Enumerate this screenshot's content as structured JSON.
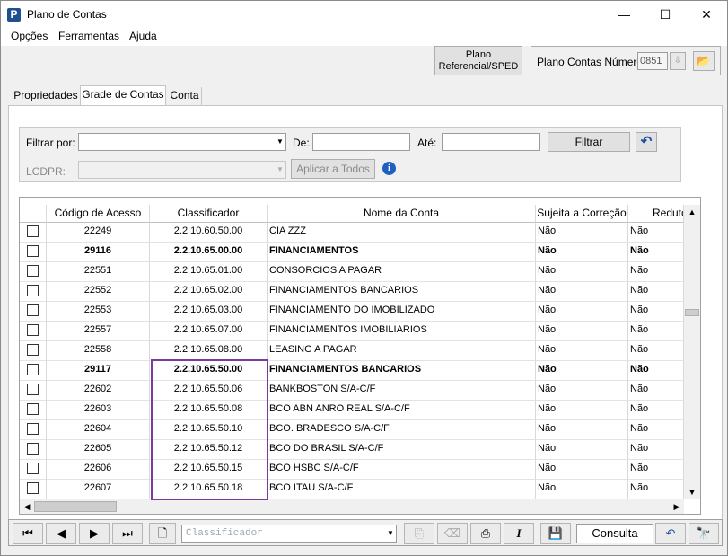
{
  "window": {
    "title": "Plano de Contas",
    "app_icon": "P",
    "minimize": "—",
    "maximize": "☐",
    "close": "✕"
  },
  "menu": {
    "items": [
      "Opções",
      "Ferramentas",
      "Ajuda"
    ]
  },
  "header": {
    "plano_btn_line1": "Plano",
    "plano_btn_line2": "Referencial/SPED",
    "numero_label": "Plano Contas Número",
    "numero_value": "0851",
    "numero_spin": "⇩",
    "folder_icon": "📂"
  },
  "tabs": [
    {
      "label": "Propriedades",
      "active": false
    },
    {
      "label": "Grade de Contas",
      "active": true
    },
    {
      "label": "Conta",
      "active": false
    }
  ],
  "filter": {
    "filtrar_por_label": "Filtrar por:",
    "de_label": "De:",
    "ate_label": "Até:",
    "filtrar_button": "Filtrar",
    "undo_icon": "↶",
    "lcdpr_label": "LCDPR:",
    "aplicar_button": "Aplicar a Todos",
    "info_icon": "i"
  },
  "grid": {
    "columns": [
      "Código de Acesso",
      "Classificador",
      "Nome da Conta",
      "Sujeita a Correção",
      "Redutora"
    ],
    "rows": [
      {
        "cod": "22249",
        "cla": "2.2.10.60.50.00",
        "nome": "CIA ZZZ",
        "suj": "Não",
        "red": "Não",
        "bold": false
      },
      {
        "cod": "29116",
        "cla": "2.2.10.65.00.00",
        "nome": "FINANCIAMENTOS",
        "suj": "Não",
        "red": "Não",
        "bold": true
      },
      {
        "cod": "22551",
        "cla": "2.2.10.65.01.00",
        "nome": "CONSORCIOS A PAGAR",
        "suj": "Não",
        "red": "Não",
        "bold": false
      },
      {
        "cod": "22552",
        "cla": "2.2.10.65.02.00",
        "nome": "FINANCIAMENTOS BANCARIOS",
        "suj": "Não",
        "red": "Não",
        "bold": false
      },
      {
        "cod": "22553",
        "cla": "2.2.10.65.03.00",
        "nome": "FINANCIAMENTO DO IMOBILIZADO",
        "suj": "Não",
        "red": "Não",
        "bold": false
      },
      {
        "cod": "22557",
        "cla": "2.2.10.65.07.00",
        "nome": "FINANCIAMENTOS IMOBILIARIOS",
        "suj": "Não",
        "red": "Não",
        "bold": false
      },
      {
        "cod": "22558",
        "cla": "2.2.10.65.08.00",
        "nome": "LEASING A PAGAR",
        "suj": "Não",
        "red": "Não",
        "bold": false
      },
      {
        "cod": "29117",
        "cla": "2.2.10.65.50.00",
        "nome": "FINANCIAMENTOS BANCARIOS",
        "suj": "Não",
        "red": "Não",
        "bold": true
      },
      {
        "cod": "22602",
        "cla": "2.2.10.65.50.06",
        "nome": "BANKBOSTON S/A-C/F",
        "suj": "Não",
        "red": "Não",
        "bold": false
      },
      {
        "cod": "22603",
        "cla": "2.2.10.65.50.08",
        "nome": "BCO ABN ANRO REAL S/A-C/F",
        "suj": "Não",
        "red": "Não",
        "bold": false
      },
      {
        "cod": "22604",
        "cla": "2.2.10.65.50.10",
        "nome": "BCO. BRADESCO S/A-C/F",
        "suj": "Não",
        "red": "Não",
        "bold": false
      },
      {
        "cod": "22605",
        "cla": "2.2.10.65.50.12",
        "nome": "BCO DO BRASIL S/A-C/F",
        "suj": "Não",
        "red": "Não",
        "bold": false
      },
      {
        "cod": "22606",
        "cla": "2.2.10.65.50.15",
        "nome": "BCO HSBC S/A-C/F",
        "suj": "Não",
        "red": "Não",
        "bold": false
      },
      {
        "cod": "22607",
        "cla": "2.2.10.65.50.18",
        "nome": "BCO ITAU S/A-C/F",
        "suj": "Não",
        "red": "Não",
        "bold": false
      }
    ]
  },
  "toolbar": {
    "first_icon": "⏮",
    "prev_icon": "◀",
    "next_icon": "▶",
    "last_icon": "⏭",
    "new_icon": "🗋",
    "classificador_placeholder": "Classificador",
    "copy_icon": "⎘",
    "delete_icon": "⌫",
    "print_icon": "⎙",
    "italic_icon": "I",
    "save_icon": "💾",
    "mode_label": "Consulta",
    "undo_icon": "↶",
    "find_icon": "🔭"
  },
  "colors": {
    "highlight": "#7a3b9c",
    "accent": "#1f5fbf"
  }
}
